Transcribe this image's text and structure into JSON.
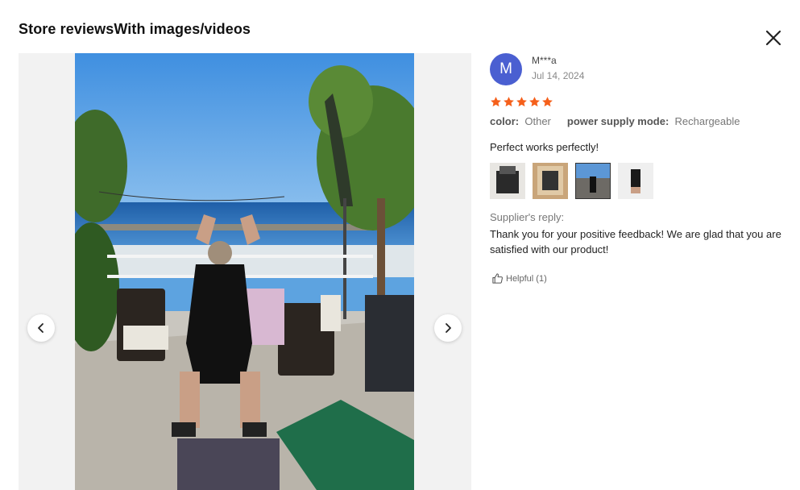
{
  "dialog": {
    "title": "Store reviewsWith images/videos"
  },
  "review": {
    "avatar_initial": "M",
    "username": "M***a",
    "date": "Jul 14, 2024",
    "rating": 5,
    "attributes": [
      {
        "key": "color",
        "value": "Other"
      },
      {
        "key": "power supply mode",
        "value": "Rechargeable"
      }
    ],
    "text": "Perfect works perfectly!",
    "thumbnails_count": 4,
    "active_thumbnail": 3,
    "supplier_reply_label": "Supplier's reply:",
    "supplier_reply": "Thank you for your positive feedback! We are glad that you are satisfied with our product!",
    "helpful_label": "Helpful (1)"
  },
  "colors": {
    "avatar": "#4a5fd1",
    "star": "#f5601b"
  },
  "icons": {
    "close": "close-icon",
    "prev": "chevron-left-icon",
    "next": "chevron-right-icon",
    "helpful": "thumbs-up-icon",
    "star": "star-icon"
  }
}
